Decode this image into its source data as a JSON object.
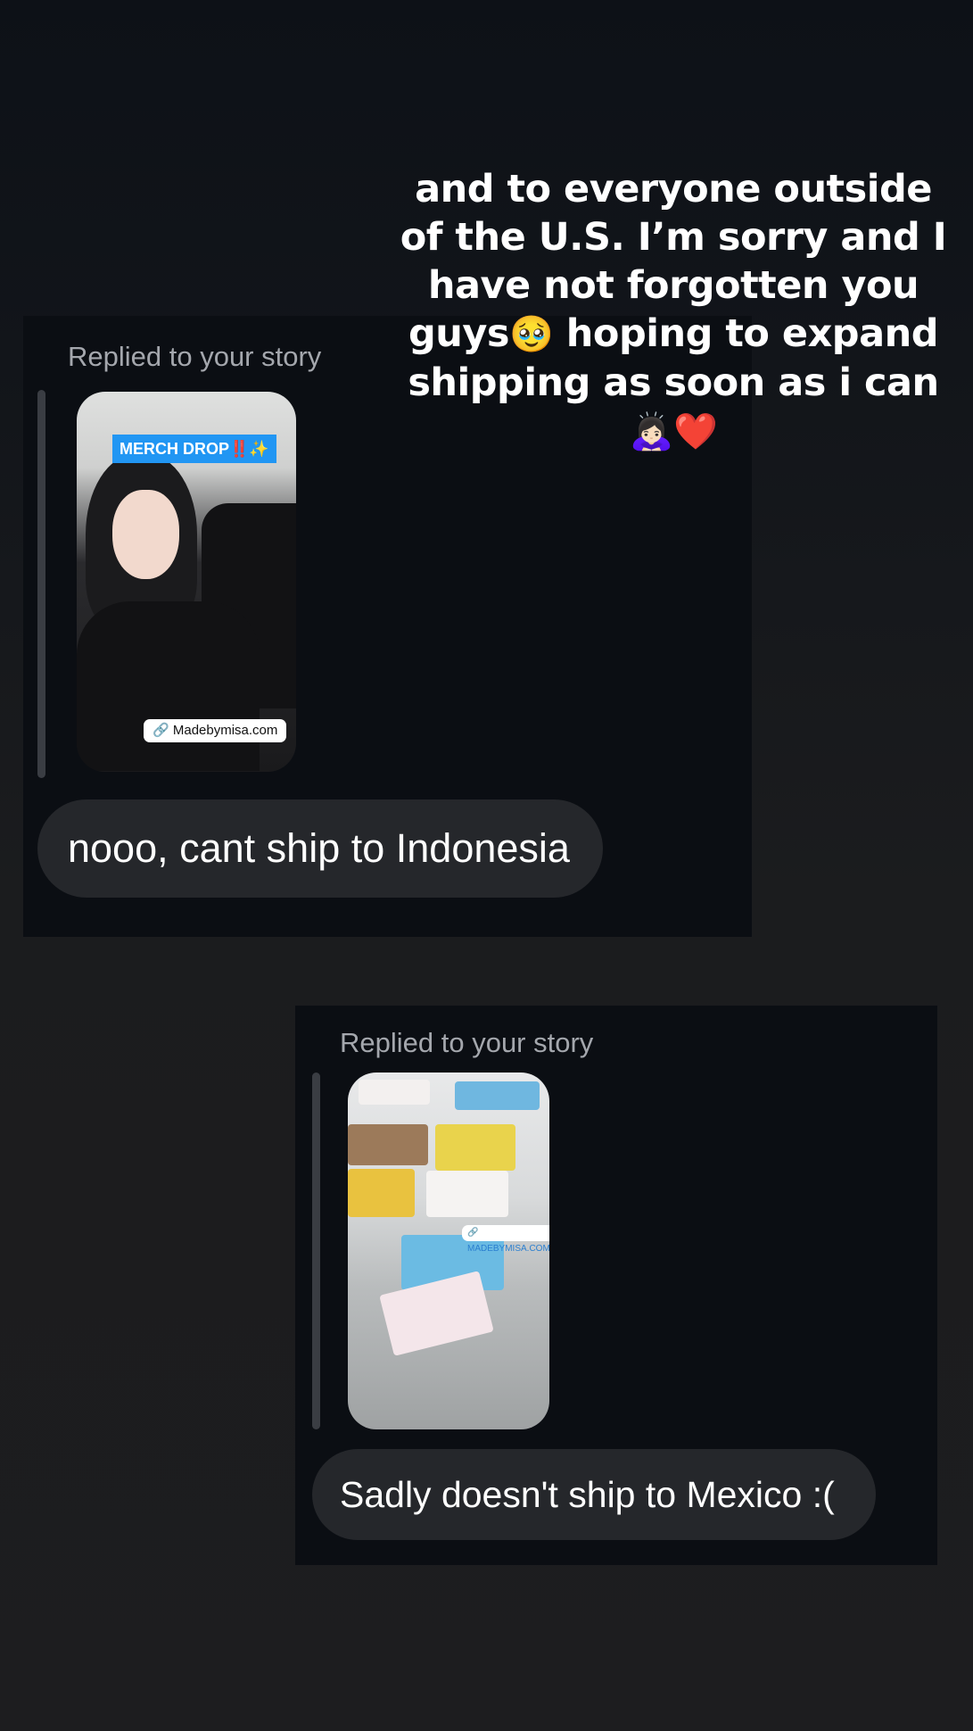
{
  "caption": {
    "line1": "and to everyone outside",
    "line2": "of the U.S. I’m sorry and I",
    "line3": "have not forgotten you",
    "line4_a": "guys",
    "line4_emoji": "🥹",
    "line4_b": " hoping to expand",
    "line5": "shipping as soon as i can",
    "line6_emoji": "🙇🏻‍♀️",
    "line6_heart": "❤️"
  },
  "messages": [
    {
      "replied_label": "Replied to your story",
      "story_tag": "MERCH DROP‼️✨",
      "story_link": "Madebymisa.com",
      "text": "nooo, cant ship to Indonesia"
    },
    {
      "replied_label": "Replied to your story",
      "story_link": "MADEBYMISA.COM",
      "text": "Sadly doesn't ship to Mexico :("
    }
  ],
  "icons": {
    "link": "link-icon",
    "pleading": "pleading-face-icon",
    "bow": "bowing-woman-icon",
    "heart": "red-heart-icon"
  },
  "colors": {
    "card_bg": "#0b0e13",
    "bubble_bg": "#25272b",
    "replied_text": "#a4a7ad",
    "merch_tag": "#2196f3"
  }
}
